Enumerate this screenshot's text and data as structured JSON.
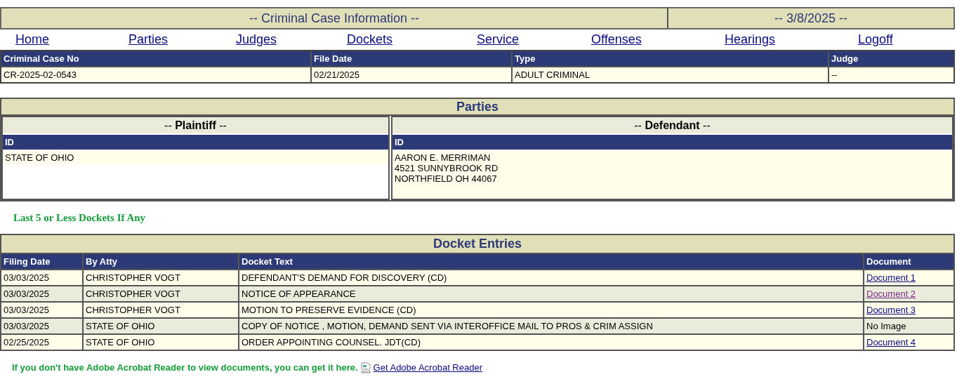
{
  "header": {
    "title": "-- Criminal Case Information --",
    "date": "-- 3/8/2025 --"
  },
  "nav": [
    "Home",
    "Parties",
    "Judges",
    "Dockets",
    "Service",
    "Offenses",
    "Hearings",
    "Logoff"
  ],
  "case": {
    "columns": [
      "Criminal Case No",
      "File Date",
      "Type",
      "Judge"
    ],
    "values": [
      "CR-2025-02-0543",
      "02/21/2025",
      "ADULT CRIMINAL",
      "--"
    ]
  },
  "parties": {
    "title": "Parties",
    "sides": [
      {
        "heading": "-- **Plaintiff** --",
        "column": "ID",
        "lines": [
          "STATE OF OHIO"
        ]
      },
      {
        "heading": "-- **Defendant** --",
        "column": "ID",
        "lines": [
          "AARON E. MERRIMAN",
          "4521 SUNNYBROOK RD",
          "NORTHFIELD OH 44067"
        ]
      }
    ]
  },
  "dockets_note": "Last 5 or Less Dockets If Any",
  "dockets": {
    "title": "Docket Entries",
    "columns": [
      "Filing Date",
      "By Atty",
      "Docket Text",
      "Document"
    ],
    "rows": [
      {
        "date": "03/03/2025",
        "atty": "CHRISTOPHER VOGT",
        "text": "DEFENDANT'S DEMAND FOR DISCOVERY (CD)",
        "document": {
          "kind": "link",
          "label": "Document 1",
          "visited": false
        }
      },
      {
        "date": "03/03/2025",
        "atty": "CHRISTOPHER VOGT",
        "text": "NOTICE OF APPEARANCE",
        "document": {
          "kind": "link",
          "label": "Document 2",
          "visited": true
        }
      },
      {
        "date": "03/03/2025",
        "atty": "CHRISTOPHER VOGT",
        "text": "MOTION TO PRESERVE EVIDENCE (CD)",
        "document": {
          "kind": "link",
          "label": "Document 3",
          "visited": false
        }
      },
      {
        "date": "03/03/2025",
        "atty": "STATE OF OHIO",
        "text": "COPY OF NOTICE , MOTION, DEMAND SENT VIA INTEROFFICE MAIL TO PROS & CRIM ASSIGN",
        "document": {
          "kind": "text",
          "label": "No Image"
        }
      },
      {
        "date": "02/25/2025",
        "atty": "STATE OF OHIO",
        "text": "ORDER APPOINTING COUNSEL. JDT(CD)",
        "document": {
          "kind": "link",
          "label": "Document 4",
          "visited": false
        }
      }
    ]
  },
  "footer": {
    "text": "If you don't have Adobe Acrobat Reader to view documents, you can get it here.",
    "link": "Get Adobe Acrobat Reader"
  }
}
